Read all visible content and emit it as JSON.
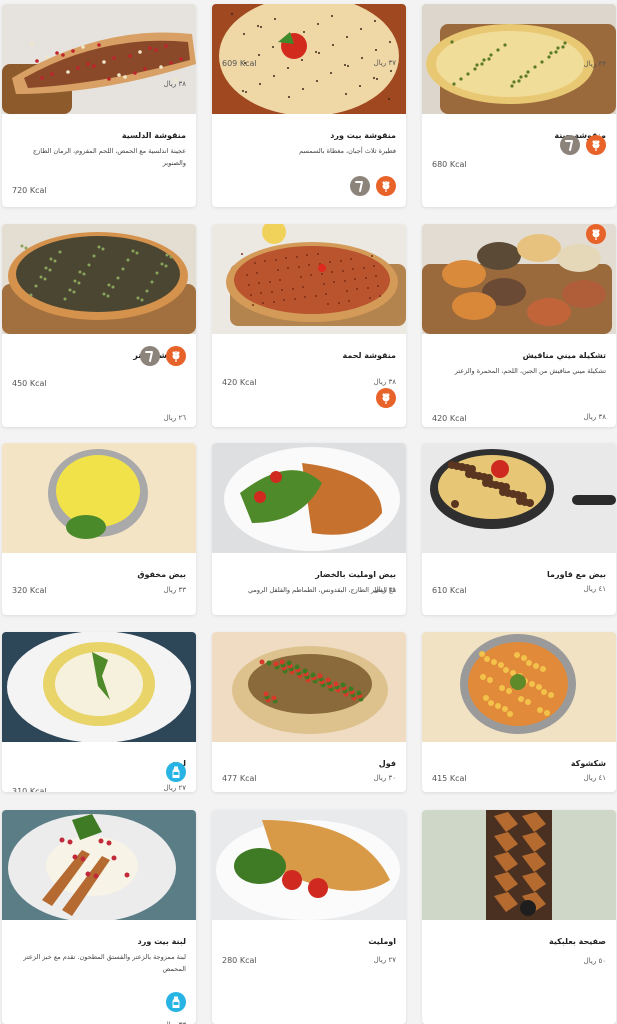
{
  "currency": "ريال",
  "calories_unit": "Kcal",
  "colors": {
    "wheat_badge": "#e8632a",
    "vegetarian_badge": "#8c837b",
    "dairy_badge": "#27b3e3"
  },
  "items": [
    {
      "title": "منقوشة جبنة",
      "description": "",
      "price": "٣٣",
      "calories": "680",
      "icons": [
        "wheat-icon",
        "vegetarian-icon"
      ],
      "photo": "cheese-manakish"
    },
    {
      "title": "منقوشة بيت ورد",
      "description": "فطيرة ثلاث أجبان، مغطاة بالسمسم",
      "price": "٣٧",
      "calories": "609",
      "icons": [
        "wheat-icon",
        "vegetarian-icon"
      ],
      "photo": "beit-ward-pie"
    },
    {
      "title": "منقوشة الدلسية",
      "description": "عجينة اندلسية مع الحمص، اللحم المفروم، الرمان الطازج والصنوبر",
      "price": "٣٨",
      "calories": "720",
      "icons": [],
      "photo": "andalusian-flatbread"
    },
    {
      "title": "تشكيلة ميني مناقيش",
      "description": "تشكيلة ميني مناقيش من الجبن، اللحم، المحمرة والزعتر",
      "price": "٣٨",
      "calories": "420",
      "icons": [
        "wheat-icon"
      ],
      "photo": "mini-manakish"
    },
    {
      "title": "منقوشة لحمة",
      "description": "",
      "price": "٣٨",
      "calories": "420",
      "icons": [
        "wheat-icon"
      ],
      "photo": "meat-manakish"
    },
    {
      "title": "منقوشة زعتر",
      "description": "",
      "price": "٢٦",
      "calories": "450",
      "icons": [
        "wheat-icon",
        "vegetarian-icon"
      ],
      "photo": "zaatar-manakish"
    },
    {
      "title": "بيض مع قاورما",
      "description": "",
      "price": "٤١",
      "calories": "610",
      "icons": [],
      "photo": "eggs-qawarma"
    },
    {
      "title": "بيض اومليت بالخضار",
      "description": "مع الفطر الطازج، البقدونس، الطماطم والفلفل الرومي",
      "price": "٣٩",
      "calories": "",
      "icons": [],
      "photo": "veg-omelette"
    },
    {
      "title": "بيض مخفوق",
      "description": "",
      "price": "٣٣",
      "calories": "320",
      "icons": [],
      "photo": "scrambled-eggs"
    },
    {
      "title": "شكشوكة",
      "description": "",
      "price": "٤١",
      "calories": "415",
      "icons": [],
      "photo": "shakshuka"
    },
    {
      "title": "فول",
      "description": "",
      "price": "٣٠",
      "calories": "477",
      "icons": [],
      "photo": "foul"
    },
    {
      "title": "لبنة",
      "description": "",
      "price": "٢٧",
      "calories": "310",
      "icons": [
        "dairy-icon"
      ],
      "photo": "labneh"
    },
    {
      "title": "صفيحة بعلبكية",
      "description": "",
      "price": "٥٠",
      "calories": "",
      "icons": [],
      "photo": "baalbak-sfiha"
    },
    {
      "title": "اومليت",
      "description": "",
      "price": "٢٧",
      "calories": "280",
      "icons": [],
      "photo": "omelette"
    },
    {
      "title": "لبنة بيت ورد",
      "description": "لبنة ممزوجة بالزعتر والفستق المطحون. تقدم مع خبز الزعتر المحمص",
      "price": "٣٣",
      "calories": "522",
      "icons": [
        "dairy-icon"
      ],
      "photo": "beit-ward-labneh"
    }
  ]
}
